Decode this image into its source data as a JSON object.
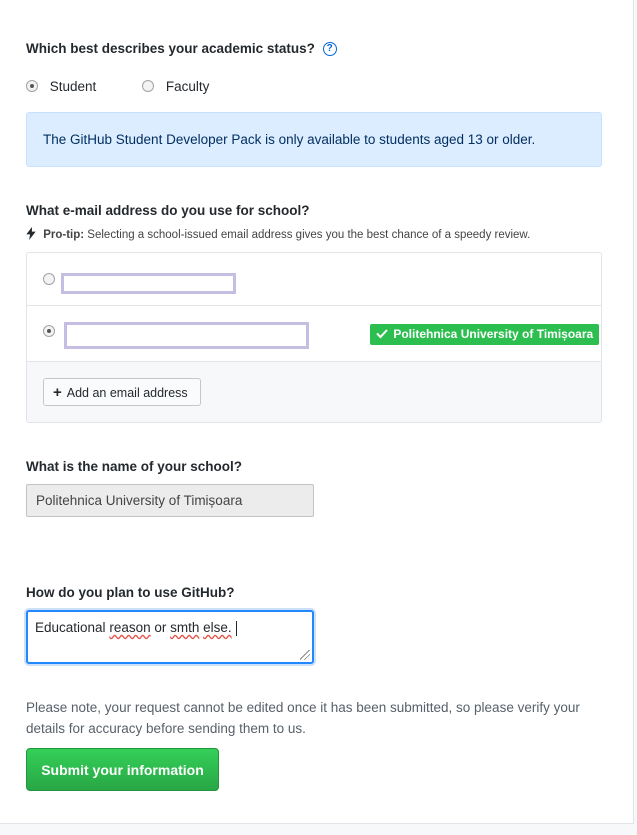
{
  "academic_status": {
    "question": "Which best describes your academic status?",
    "help_icon": "question-circle-icon",
    "options": [
      {
        "label": "Student",
        "checked": true
      },
      {
        "label": "Faculty",
        "checked": false
      }
    ]
  },
  "flash": {
    "message": "The GitHub Student Developer Pack is only available to students aged 13 or older."
  },
  "email": {
    "question": "What e-mail address do you use for school?",
    "protip_icon": "zap-icon",
    "protip_label": "Pro-tip:",
    "protip_text": "Selecting a school-issued email address gives you the best chance of a speedy review.",
    "addresses": [
      {
        "selected": false,
        "redacted": true
      },
      {
        "selected": true,
        "redacted": true,
        "badge": "Politehnica University of Timișoara"
      }
    ],
    "badge_icon": "check-icon",
    "add_button": "Add an email address",
    "add_icon": "plus-icon"
  },
  "school": {
    "question": "What is the name of your school?",
    "value": "Politehnica University of Timișoara"
  },
  "usage": {
    "question": "How do you plan to use GitHub?",
    "words": [
      "Educational",
      " ",
      "reason",
      " or ",
      "smth",
      " ",
      "else."
    ]
  },
  "note": "Please note, your request cannot be edited once it has been submitted, so please verify your details for accuracy before sending them to us.",
  "submit_label": "Submit your information",
  "colors": {
    "accent_blue": "#0366d6",
    "success_green": "#2cbe4e",
    "flash_bg": "#dbedff",
    "redaction": "#c5bde2"
  }
}
